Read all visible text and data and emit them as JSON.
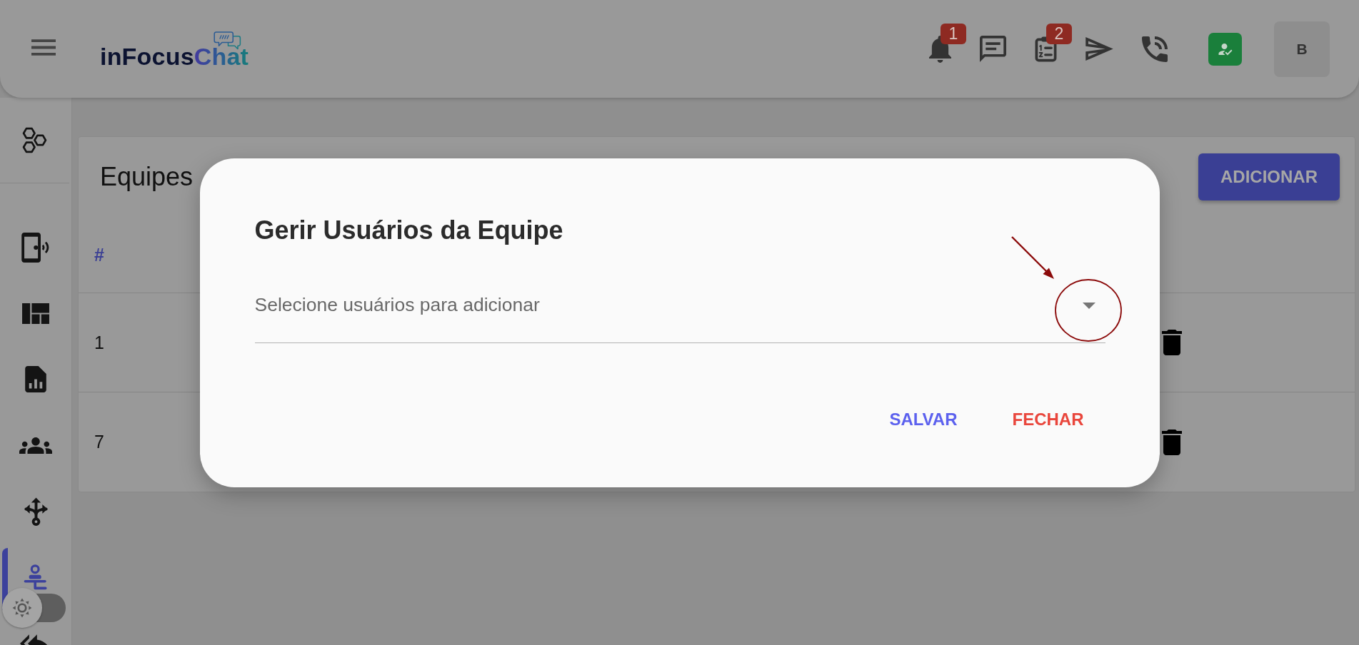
{
  "app_bar": {
    "logo": {
      "parts": [
        "inFocus",
        "Chat"
      ]
    },
    "actions": [
      {
        "kind": "bell",
        "badge": "1"
      },
      {
        "kind": "chat"
      },
      {
        "kind": "checklist",
        "badge": "2"
      },
      {
        "kind": "send"
      },
      {
        "kind": "phone"
      },
      {
        "kind": "user-check"
      }
    ],
    "avatar": {
      "initial": "B"
    }
  },
  "sidebar": {
    "sections": [
      {
        "items": [
          {
            "kind": "hexagons",
            "selected": false
          }
        ]
      },
      {
        "items": [
          {
            "kind": "phone-signal",
            "selected": false
          },
          {
            "kind": "dashboard",
            "selected": false
          },
          {
            "kind": "report",
            "selected": false
          },
          {
            "kind": "group",
            "selected": false
          },
          {
            "kind": "split",
            "selected": false
          },
          {
            "kind": "agent",
            "selected": true
          },
          {
            "kind": "reply-all",
            "selected": false
          }
        ]
      }
    ],
    "theme_switch": {
      "on": false
    }
  },
  "page": {
    "title": "Equipes",
    "add_button": "ADICIONAR",
    "table": {
      "columns": [
        "#"
      ],
      "rows": [
        [
          "1"
        ],
        [
          "7"
        ]
      ]
    }
  },
  "dialog": {
    "title": "Gerir Usuários da Equipe",
    "select": {
      "placeholder": "Selecione usuários para adicionar"
    },
    "buttons": [
      {
        "label": "SALVAR",
        "kind": "primary"
      },
      {
        "label": "FECHAR",
        "kind": "danger"
      }
    ]
  }
}
